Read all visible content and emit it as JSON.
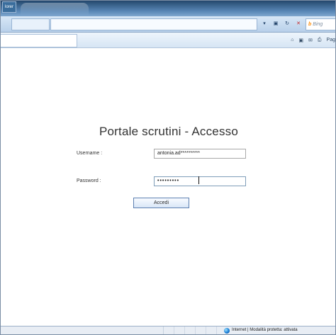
{
  "browser": {
    "title_fragment": "lorer",
    "search_provider": "Bing",
    "toolbar_visible": [
      "Pag"
    ]
  },
  "page": {
    "heading": "Portale scrutini - Accesso",
    "username_label": "Username :",
    "username_value": "antonia.ad**********",
    "password_label": "Password :",
    "password_value": "•••••••••",
    "submit_label": "Accedi"
  },
  "status": {
    "zone": "Internet | Modalità protetta: attivata"
  },
  "colors": {
    "accent": "#2f6ea5",
    "button_border": "#5c7fb0"
  },
  "icons": {
    "search": "search-icon",
    "refresh": "refresh-icon",
    "stop": "stop-icon",
    "home": "home-icon",
    "rss": "rss-icon",
    "print": "print-icon",
    "globe": "globe-icon"
  }
}
